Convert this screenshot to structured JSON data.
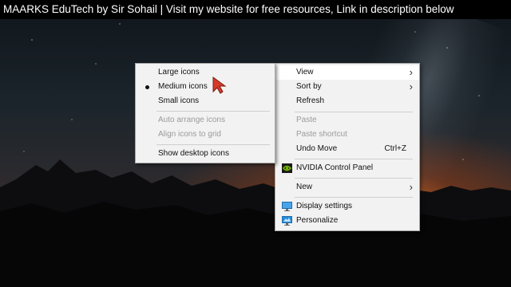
{
  "banner": {
    "text": "MAARKS EduTech by Sir Sohail | Visit my website for free resources, Link in description below"
  },
  "context_menu": {
    "items": [
      {
        "label": "View",
        "arrow": "›"
      },
      {
        "label": "Sort by",
        "arrow": "›"
      },
      {
        "label": "Refresh"
      },
      {
        "label": "Paste"
      },
      {
        "label": "Paste shortcut"
      },
      {
        "label": "Undo Move",
        "shortcut": "Ctrl+Z"
      },
      {
        "label": "NVIDIA Control Panel",
        "icon": "nvidia-icon"
      },
      {
        "label": "New",
        "arrow": "›"
      },
      {
        "label": "Display settings",
        "icon": "display-icon"
      },
      {
        "label": "Personalize",
        "icon": "personalize-icon"
      }
    ]
  },
  "view_submenu": {
    "items": [
      {
        "label": "Large icons"
      },
      {
        "label": "Medium icons",
        "selected": true
      },
      {
        "label": "Small icons"
      },
      {
        "label": "Auto arrange icons"
      },
      {
        "label": "Align icons to grid"
      },
      {
        "label": "Show desktop icons"
      }
    ]
  },
  "colors": {
    "menu_bg": "#f2f2f2",
    "disabled_text": "#9a9a9a",
    "nvidia_green": "#76b900",
    "cursor_red": "#d63a2a",
    "display_blue": "#2a8ad4"
  }
}
